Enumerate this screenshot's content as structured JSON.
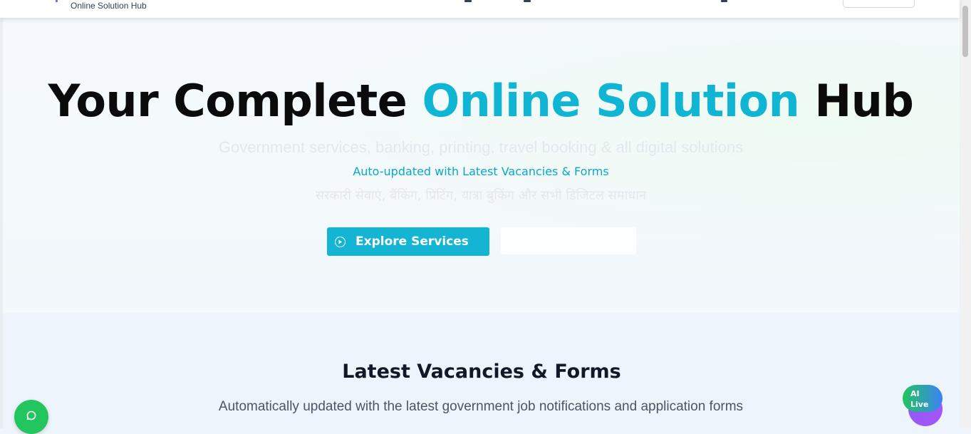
{
  "header": {
    "brand_subtitle": "Online Solution Hub"
  },
  "hero": {
    "title_part1": "Your Complete ",
    "title_accent": "Online Solution",
    "title_part2": " Hub",
    "subtitle": "Government services, banking, printing, travel booking & all digital solutions",
    "auto_update": "Auto-updated with Latest Vacancies & Forms",
    "hindi": "सरकारी सेवाएं, बैंकिंग, प्रिंटिंग, यात्रा बुकिंग और सभी डिजिटल समाधान",
    "explore_label": "Explore Services"
  },
  "vacancies": {
    "title": "Latest Vacancies & Forms",
    "description": "Automatically updated with the latest government job notifications and application forms"
  },
  "ai_widget": {
    "label_line1": "AI",
    "label_line2": "Live"
  },
  "colors": {
    "accent": "#0fb5d3",
    "button": "#13b5d2",
    "chat_green": "#22c55e"
  },
  "icons": [
    "play-icon",
    "chat-icon",
    "ai-chat-icon",
    "search-icon"
  ]
}
